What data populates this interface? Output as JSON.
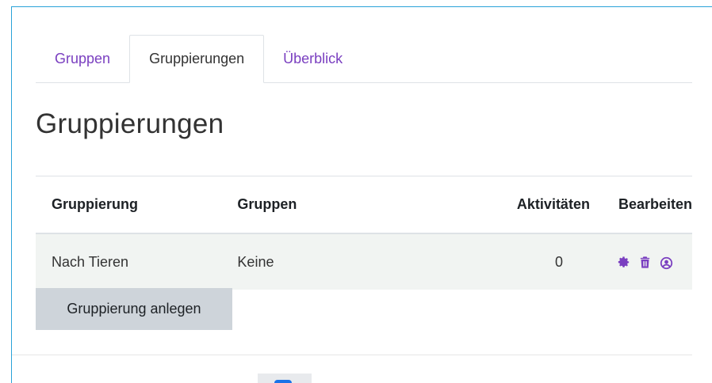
{
  "tabs": [
    {
      "label": "Gruppen",
      "active": false
    },
    {
      "label": "Gruppierungen",
      "active": true
    },
    {
      "label": "Überblick",
      "active": false
    }
  ],
  "page_title": "Gruppierungen",
  "table": {
    "headers": [
      "Gruppierung",
      "Gruppen",
      "Aktivitäten",
      "Bearbeiten"
    ],
    "rows": [
      {
        "name": "Nach Tieren",
        "groups": "Keine",
        "activities": "0",
        "actions": [
          "gear-icon",
          "trash-icon",
          "user-circle-icon"
        ]
      }
    ]
  },
  "create_button_label": "Gruppierung anlegen",
  "colors": {
    "accent": "#7a3fc0",
    "frame": "#2aa3d8",
    "row_bg": "#f1f4f2",
    "button_bg": "#ced4da"
  }
}
